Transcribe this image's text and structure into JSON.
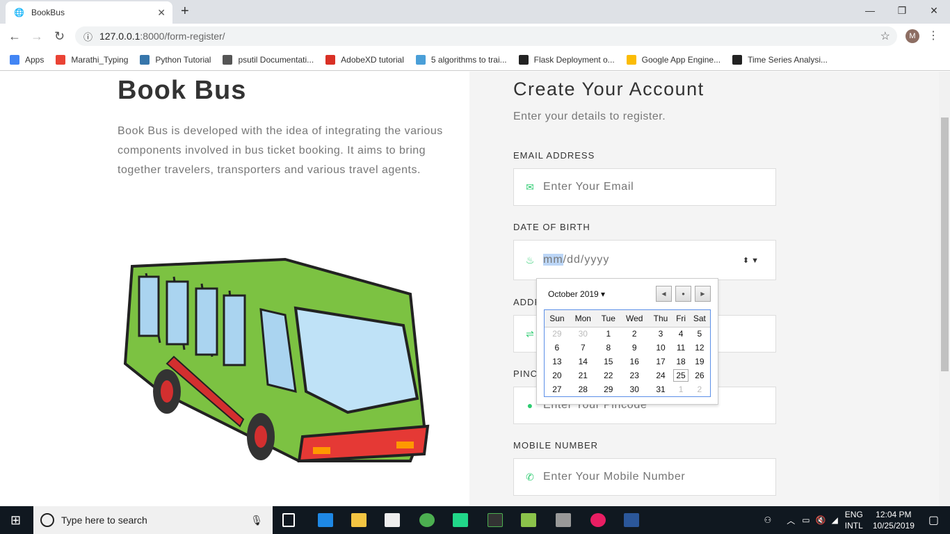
{
  "browser": {
    "tab_title": "BookBus",
    "url_host": "127.0.0.1",
    "url_path": ":8000/form-register/",
    "profile_initial": "M",
    "bookmarks": [
      {
        "label": "Apps",
        "color": "#4285f4"
      },
      {
        "label": "Marathi_Typing",
        "color": "#ea4335"
      },
      {
        "label": "Python Tutorial",
        "color": "#3776ab"
      },
      {
        "label": "psutil Documentati...",
        "color": "#555555"
      },
      {
        "label": "AdobeXD tutorial",
        "color": "#d93025"
      },
      {
        "label": "5 algorithms to trai...",
        "color": "#4a9fd8"
      },
      {
        "label": "Flask Deployment o...",
        "color": "#222222"
      },
      {
        "label": "Google App Engine...",
        "color": "#fbbc05"
      },
      {
        "label": "Time Series Analysi...",
        "color": "#222222"
      }
    ]
  },
  "left": {
    "title": "Book Bus",
    "description": "Book Bus is developed with the idea of integrating the various components involved in bus ticket booking. It aims to bring together travelers, transporters and various travel agents."
  },
  "form": {
    "title": "Create Your Account",
    "subtitle": "Enter your details to register.",
    "email_label": "EMAIL ADDRESS",
    "email_placeholder": "Enter Your Email",
    "dob_label": "DATE OF BIRTH",
    "dob_mm": "mm",
    "dob_rest": "/dd/yyyy",
    "address_label": "ADDRESS",
    "pincode_label": "PINCODE",
    "pincode_placeholder": "Enter Your Pincode",
    "mobile_label": "MOBILE NUMBER",
    "mobile_placeholder": "Enter Your Mobile Number",
    "accent": "#2ecc71"
  },
  "calendar": {
    "month": "October 2019",
    "weekdays": [
      "Sun",
      "Mon",
      "Tue",
      "Wed",
      "Thu",
      "Fri",
      "Sat"
    ],
    "weeks": [
      [
        "29",
        "30",
        "1",
        "2",
        "3",
        "4",
        "5"
      ],
      [
        "6",
        "7",
        "8",
        "9",
        "10",
        "11",
        "12"
      ],
      [
        "13",
        "14",
        "15",
        "16",
        "17",
        "18",
        "19"
      ],
      [
        "20",
        "21",
        "22",
        "23",
        "24",
        "25",
        "26"
      ],
      [
        "27",
        "28",
        "29",
        "30",
        "31",
        "1",
        "2"
      ]
    ],
    "today": "25"
  },
  "taskbar": {
    "search_placeholder": "Type here to search",
    "lang1": "ENG",
    "lang2": "INTL",
    "time": "12:04 PM",
    "date": "10/25/2019"
  }
}
